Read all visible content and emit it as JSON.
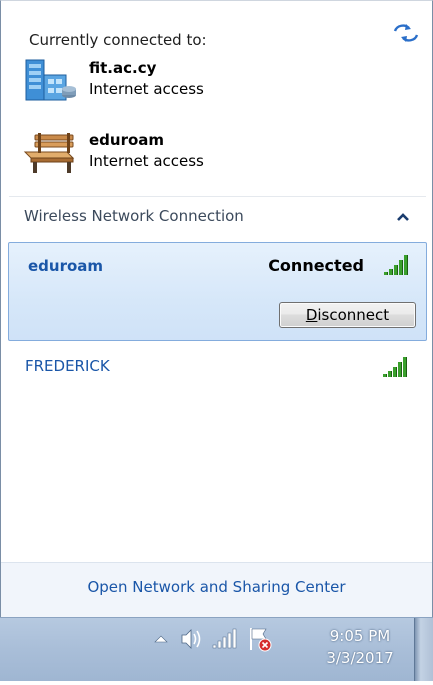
{
  "header": {
    "title": "Currently connected to:",
    "refresh_icon": "refresh-arrows-icon"
  },
  "connected_networks": [
    {
      "name": "fit.ac.cy",
      "status": "Internet access",
      "icon": "domain-network-icon"
    },
    {
      "name": "eduroam",
      "status": "Internet access",
      "icon": "public-network-bench-icon"
    }
  ],
  "section": {
    "title": "Wireless Network Connection",
    "collapse_icon": "chevron-up-icon"
  },
  "wireless_networks": [
    {
      "ssid": "eduroam",
      "status": "Connected",
      "button": "Disconnect",
      "button_access_key": "D",
      "button_rest": "isconnect",
      "signal_bars": 5
    },
    {
      "ssid": "FREDERICK",
      "signal_bars": 5
    }
  ],
  "footer": {
    "link": "Open Network and Sharing Center"
  },
  "taskbar": {
    "time": "9:05 PM",
    "date": "3/3/2017",
    "icons": [
      "show-hidden-icons-arrow-icon",
      "speaker-volume-icon",
      "network-signal-icon",
      "action-center-flag-icon"
    ]
  },
  "colors": {
    "link_blue": "#1a56a8",
    "selection_border": "#84acdd",
    "signal_green": "#3aa02c",
    "taskbar": "#a9bed8"
  }
}
